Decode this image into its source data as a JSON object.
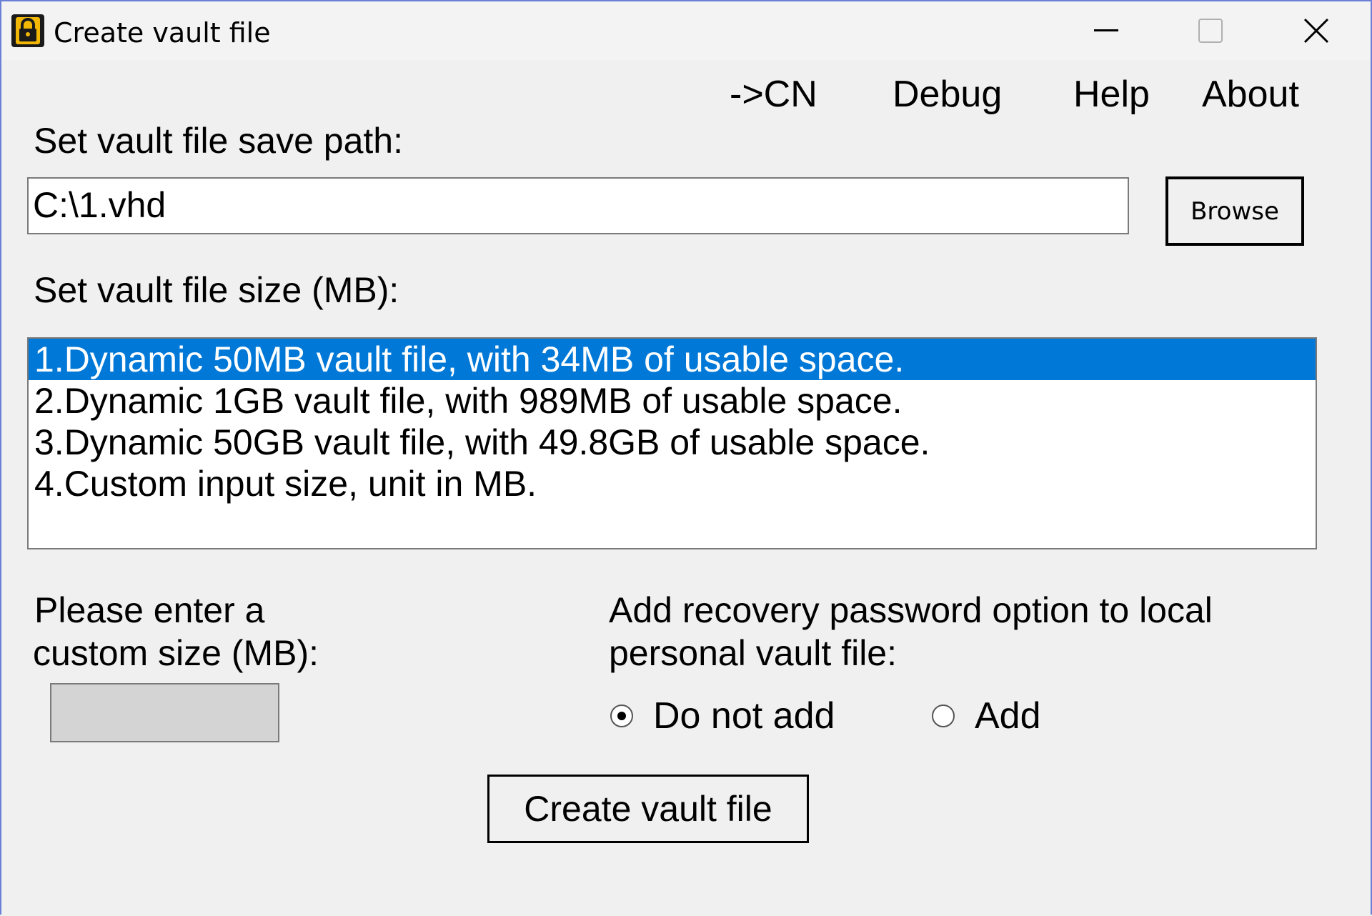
{
  "window": {
    "title": "Create vault file",
    "icon": "padlock-icon",
    "controls": {
      "minimize": "minimize-icon",
      "maximize": "maximize-icon",
      "close": "close-icon"
    }
  },
  "menu": {
    "items": [
      {
        "label": "->CN"
      },
      {
        "label": "Debug"
      },
      {
        "label": "Help"
      },
      {
        "label": "About"
      }
    ]
  },
  "save_path": {
    "label": "Set vault file save path:",
    "value": "C:\\1.vhd",
    "browse_label": "Browse"
  },
  "size": {
    "label": "Set vault file size (MB):",
    "options": [
      {
        "label": "1.Dynamic 50MB vault file, with 34MB of usable space.",
        "selected": true
      },
      {
        "label": "2.Dynamic 1GB vault file, with 989MB of usable space.",
        "selected": false
      },
      {
        "label": "3.Dynamic 50GB vault file, with 49.8GB of usable space.",
        "selected": false
      },
      {
        "label": "4.Custom input size, unit in MB.",
        "selected": false
      }
    ]
  },
  "custom_size": {
    "label_line1": "Please enter a",
    "label_line2": "custom size (MB):",
    "value": ""
  },
  "recovery": {
    "label_line1": "Add recovery password option to local",
    "label_line2": "personal vault file:",
    "options": [
      {
        "label": "Do not add",
        "checked": true
      },
      {
        "label": "Add",
        "checked": false
      }
    ]
  },
  "actions": {
    "create_label": "Create vault file"
  },
  "colors": {
    "selection": "#0078d7",
    "window_border": "#6a7fd6",
    "background": "#f0f0f0",
    "icon_gold": "#f2b705"
  }
}
